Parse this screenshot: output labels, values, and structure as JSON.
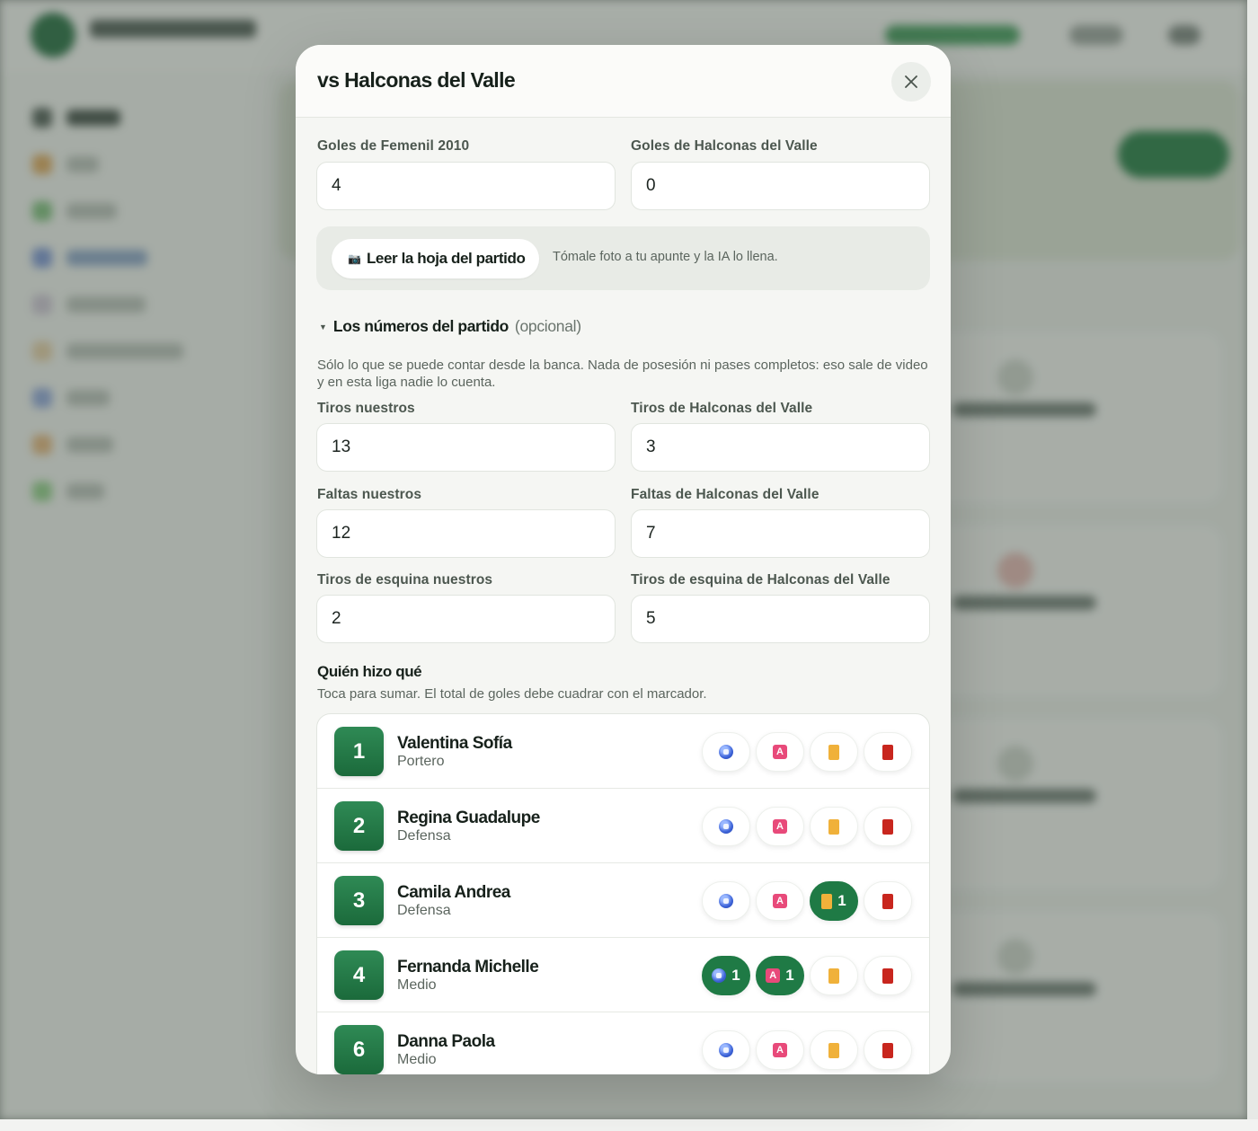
{
  "modal": {
    "title": "vs Halconas del Valle",
    "close_icon": "close-icon"
  },
  "score": {
    "home_label": "Goles de Femenil 2010",
    "home_value": "4",
    "away_label": "Goles de Halconas del Valle",
    "away_value": "0"
  },
  "ai_reader": {
    "button_icon": "camera-icon",
    "button_label": "Leer la hoja del partido",
    "hint": "Tómale foto a tu apunte y la IA lo llena."
  },
  "stats_section": {
    "toggle_icon": "triangle-down-icon",
    "title": "Los números del partido",
    "optional": "(opcional)",
    "description": "Sólo lo que se puede contar desde la banca. Nada de posesión ni pases completos: eso sale de video y en esta liga nadie lo cuenta.",
    "shots_home_label": "Tiros nuestros",
    "shots_home_value": "13",
    "shots_away_label": "Tiros de Halconas del Valle",
    "shots_away_value": "3",
    "fouls_home_label": "Faltas nuestros",
    "fouls_home_value": "12",
    "fouls_away_label": "Faltas de Halconas del Valle",
    "fouls_away_value": "7",
    "corners_home_label": "Tiros de esquina nuestros",
    "corners_home_value": "2",
    "corners_away_label": "Tiros de esquina de Halconas del Valle",
    "corners_away_value": "5"
  },
  "who_did_what": {
    "title": "Quién hizo qué",
    "description": "Toca para sumar. El total de goles debe cuadrar con el marcador.",
    "stat_icons": [
      "goal-ball-icon",
      "assist-icon",
      "yellow-card-icon",
      "red-card-icon"
    ],
    "colors": {
      "active": "#1f7a45",
      "yellow_card": "#f0b13a",
      "red_card": "#c8261e",
      "assist": "#e84a7a",
      "ball": "#3d63d8"
    },
    "players": [
      {
        "number": "1",
        "name": "Valentina Sofía",
        "position": "Portero",
        "goals": 0,
        "assists": 0,
        "yellow": 0,
        "red": 0
      },
      {
        "number": "2",
        "name": "Regina Guadalupe",
        "position": "Defensa",
        "goals": 0,
        "assists": 0,
        "yellow": 0,
        "red": 0
      },
      {
        "number": "3",
        "name": "Camila Andrea",
        "position": "Defensa",
        "goals": 0,
        "assists": 0,
        "yellow": 1,
        "red": 0
      },
      {
        "number": "4",
        "name": "Fernanda Michelle",
        "position": "Medio",
        "goals": 1,
        "assists": 1,
        "yellow": 0,
        "red": 0
      },
      {
        "number": "6",
        "name": "Danna Paola",
        "position": "Medio",
        "goals": 0,
        "assists": 0,
        "yellow": 0,
        "red": 0
      }
    ]
  }
}
